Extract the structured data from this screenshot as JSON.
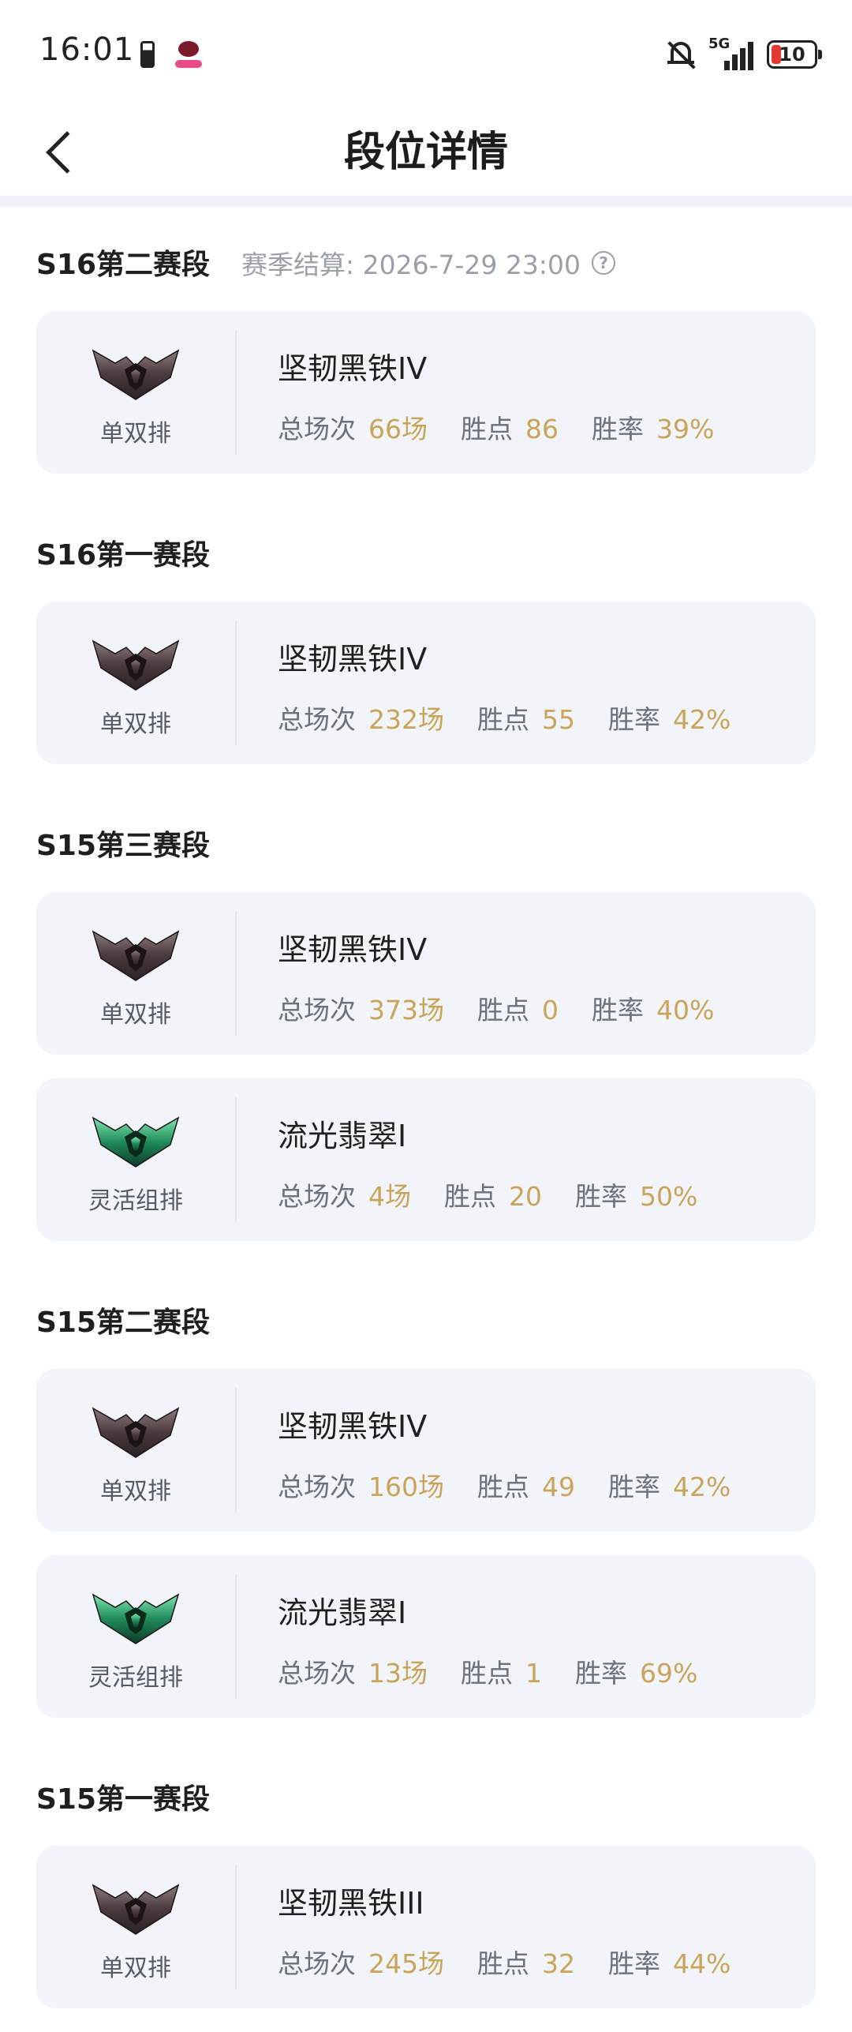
{
  "statusbar": {
    "time": "16:01",
    "network": "5G",
    "battery": "10",
    "icons": [
      "battery-small-icon",
      "app-icon",
      "bell-off-icon",
      "signal-icon",
      "battery-icon"
    ]
  },
  "header": {
    "title": "段位详情",
    "back_icon": "chevron-left-icon"
  },
  "labels": {
    "total_games": "总场次",
    "lp": "胜点",
    "win_rate": "胜率"
  },
  "sections": [
    {
      "title": "S16第二赛段",
      "season_end": "赛季结算: 2026-7-29 23:00",
      "help_icon": "?",
      "cards": [
        {
          "queue": "单双排",
          "rank": "坚韧黑铁IV",
          "games": "66场",
          "lp": "86",
          "win_rate": "39%",
          "emblem": "iron"
        }
      ]
    },
    {
      "title": "S16第一赛段",
      "cards": [
        {
          "queue": "单双排",
          "rank": "坚韧黑铁IV",
          "games": "232场",
          "lp": "55",
          "win_rate": "42%",
          "emblem": "iron"
        }
      ]
    },
    {
      "title": "S15第三赛段",
      "cards": [
        {
          "queue": "单双排",
          "rank": "坚韧黑铁IV",
          "games": "373场",
          "lp": "0",
          "win_rate": "40%",
          "emblem": "iron"
        },
        {
          "queue": "灵活组排",
          "rank": "流光翡翠I",
          "games": "4场",
          "lp": "20",
          "win_rate": "50%",
          "emblem": "emerald"
        }
      ]
    },
    {
      "title": "S15第二赛段",
      "cards": [
        {
          "queue": "单双排",
          "rank": "坚韧黑铁IV",
          "games": "160场",
          "lp": "49",
          "win_rate": "42%",
          "emblem": "iron"
        },
        {
          "queue": "灵活组排",
          "rank": "流光翡翠I",
          "games": "13场",
          "lp": "1",
          "win_rate": "69%",
          "emblem": "emerald"
        }
      ]
    },
    {
      "title": "S15第一赛段",
      "cards": [
        {
          "queue": "单双排",
          "rank": "坚韧黑铁III",
          "games": "245场",
          "lp": "32",
          "win_rate": "44%",
          "emblem": "iron"
        }
      ]
    }
  ],
  "colors": {
    "accent_value": "#c9a45a",
    "card_bg": "#f1f4f9",
    "muted_text": "#9aa0aa",
    "iron_emblem": "#4a3a3a",
    "emerald_emblem": "#1f8a5a"
  }
}
